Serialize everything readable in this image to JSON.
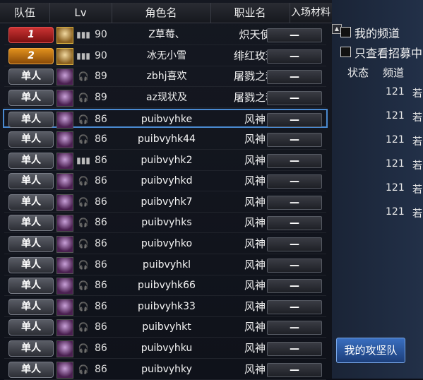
{
  "headers": {
    "team": "队伍",
    "lv": "Lv",
    "role": "角色名",
    "job": "职业名",
    "materials": "入场材料"
  },
  "rows": [
    {
      "team": "1",
      "lv": "90",
      "name": "Z草莓、",
      "job": "炽天使",
      "mat": "—"
    },
    {
      "team": "2",
      "lv": "90",
      "name": "冰无小雪",
      "job": "绯红玫瑰",
      "mat": "—"
    },
    {
      "team": "单人",
      "lv": "89",
      "name": "zbhj喜欢",
      "job": "屠戮之魂",
      "mat": "—"
    },
    {
      "team": "单人",
      "lv": "89",
      "name": "az现状及",
      "job": "屠戮之魂",
      "mat": "—"
    },
    {
      "team": "单人",
      "lv": "86",
      "name": "puibvyhke",
      "job": "风神",
      "mat": "—"
    },
    {
      "team": "单人",
      "lv": "86",
      "name": "puibvyhk44",
      "job": "风神",
      "mat": "—"
    },
    {
      "team": "单人",
      "lv": "86",
      "name": "puibvyhk2",
      "job": "风神",
      "mat": "—"
    },
    {
      "team": "单人",
      "lv": "86",
      "name": "puibvyhkd",
      "job": "风神",
      "mat": "—"
    },
    {
      "team": "单人",
      "lv": "86",
      "name": "puibvyhk7",
      "job": "风神",
      "mat": "—"
    },
    {
      "team": "单人",
      "lv": "86",
      "name": "puibvyhks",
      "job": "风神",
      "mat": "—"
    },
    {
      "team": "单人",
      "lv": "86",
      "name": "puibvyhko",
      "job": "风神",
      "mat": "—"
    },
    {
      "team": "单人",
      "lv": "86",
      "name": "puibvyhkl",
      "job": "风神",
      "mat": "—"
    },
    {
      "team": "单人",
      "lv": "86",
      "name": "puibvyhk66",
      "job": "风神",
      "mat": "—"
    },
    {
      "team": "单人",
      "lv": "86",
      "name": "puibvyhk33",
      "job": "风神",
      "mat": "—"
    },
    {
      "team": "单人",
      "lv": "86",
      "name": "puibvyhkt",
      "job": "风神",
      "mat": "—"
    },
    {
      "team": "单人",
      "lv": "86",
      "name": "puibvyhku",
      "job": "风神",
      "mat": "—"
    },
    {
      "team": "单人",
      "lv": "86",
      "name": "puibvyhky",
      "job": "风神",
      "mat": "—"
    }
  ],
  "panel": {
    "my_channel": "我的频道",
    "recruit_only": "只查看招募中",
    "col_status": "状态",
    "col_channel": "频道",
    "channel_values": [
      "121",
      "121",
      "121",
      "121",
      "121",
      "121"
    ],
    "channel_suffix": "若",
    "attack_team_button": "我的攻坚队"
  },
  "colors": {
    "selected_row_border": "#4a8ad0",
    "team1_badge": "#c33333",
    "team2_badge": "#e0901c"
  }
}
